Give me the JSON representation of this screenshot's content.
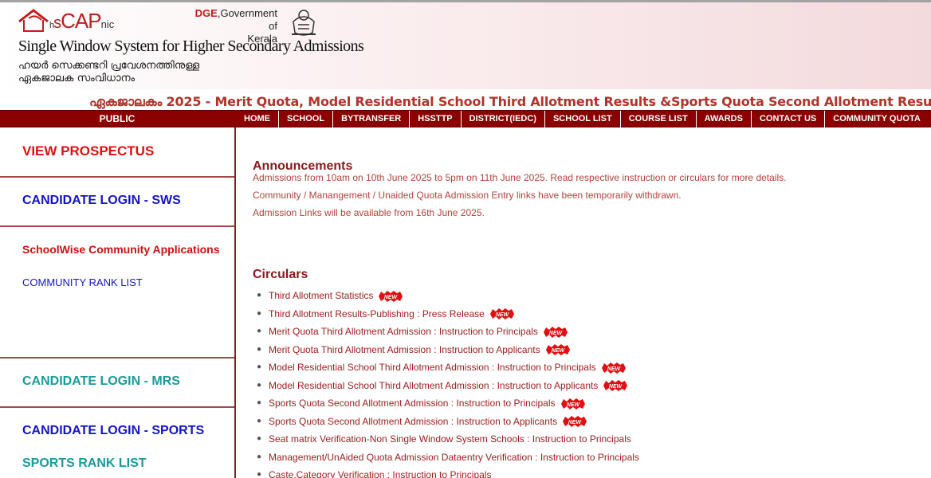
{
  "header": {
    "logo_h": "h",
    "logo_s": "s",
    "logo_cap": "CAP",
    "logo_nic": "nic",
    "dge_bold": "DGE",
    "dge_rest": ",Government of",
    "dge_line2": "Kerala",
    "title": "Single Window System for Higher Secondary Admissions",
    "ml_line1": "ഹയർ സെക്കണ്ടറി പ്രവേശനത്തിനുള്ള",
    "ml_line2": "ഏകജാലക സംവിധാനം"
  },
  "marquee": {
    "text": "ഏകജാലകം 2025 - Merit Quota, Model Residential School Third Allotment Results &Sports Quota Second Allotment Results Published."
  },
  "nav": {
    "public_label": "PUBLIC",
    "items": [
      "HOME",
      "SCHOOL",
      "BYTRANSFER",
      "HSSTTP",
      "DISTRICT(IEDC)",
      "SCHOOL LIST",
      "COURSE LIST",
      "AWARDS",
      "CONTACT US",
      "COMMUNITY QUOTA"
    ]
  },
  "sidebar": {
    "view_prospectus": "VIEW PROSPECTUS",
    "candidate_login_sws": "CANDIDATE LOGIN - SWS",
    "schoolwise_community": "SchoolWise Community Applications",
    "community_rank_list": "COMMUNITY RANK LIST",
    "candidate_login_mrs": "CANDIDATE LOGIN - MRS",
    "candidate_login_sports": "CANDIDATE LOGIN - SPORTS",
    "sports_rank_list": "SPORTS RANK LIST"
  },
  "announcements": {
    "title": "Announcements",
    "lines": [
      "Admissions from 10am on 10th June 2025 to 5pm on 11th June 2025. Read respective instruction or circulars for more details.",
      "Community / Manangement / Unaided Quota Admission Entry links have been temporarily withdrawn.",
      "Admission Links will be available from 16th June 2025."
    ]
  },
  "circulars": {
    "title": "Circulars",
    "new_badge": "NEW",
    "items": [
      {
        "text": "Third Allotment Statistics",
        "is_new": true
      },
      {
        "text": "Third Allotment Results-Publishing : Press Release",
        "is_new": true
      },
      {
        "text": "Merit Quota Third Allotment Admission : Instruction to Principals",
        "is_new": true
      },
      {
        "text": "Merit Quota Third Allotment Admission : Instruction to Applicants",
        "is_new": true
      },
      {
        "text": "Model Residential School Third Allotment Admission : Instruction to Principals",
        "is_new": true
      },
      {
        "text": "Model Residential School Third Allotment Admission : Instruction to Applicants",
        "is_new": true
      },
      {
        "text": "Sports Quota Second Allotment Admission : Instruction to Principals",
        "is_new": true
      },
      {
        "text": "Sports Quota Second Allotment Admission : Instruction to Applicants",
        "is_new": true
      },
      {
        "text": "Seat matrix Verification-Non Single Window System Schools : Instruction to Principals",
        "is_new": false
      },
      {
        "text": "Management/UnAided Quota Admission Dataentry Verification : Instruction to Principals",
        "is_new": false
      },
      {
        "text": "Caste,Category Verification : Instruction to Principals",
        "is_new": false
      }
    ]
  },
  "colors": {
    "nav_bg": "#8b0000",
    "marquee_text": "#b1332b",
    "section_title": "#8b1a1a",
    "sidebar_red": "#e01010",
    "sidebar_blue": "#1414c8",
    "sidebar_teal": "#1a9a9a"
  }
}
